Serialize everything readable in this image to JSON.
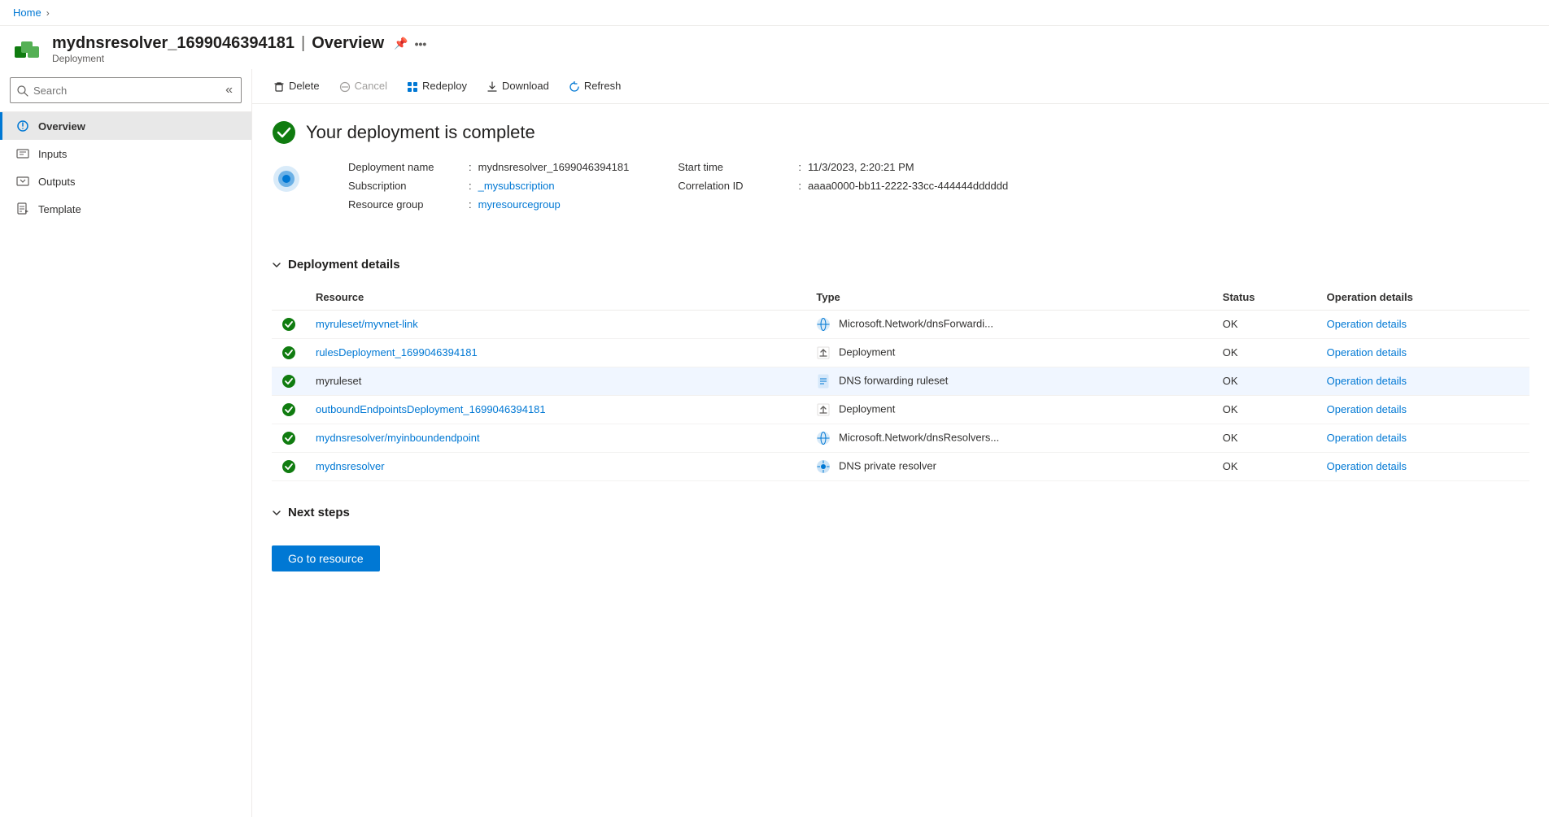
{
  "breadcrumb": {
    "home_label": "Home"
  },
  "header": {
    "title": "mydnsresolver_1699046394181",
    "separator": "|",
    "page": "Overview",
    "subtitle": "Deployment"
  },
  "sidebar": {
    "search_placeholder": "Search",
    "nav_items": [
      {
        "id": "overview",
        "label": "Overview",
        "active": true
      },
      {
        "id": "inputs",
        "label": "Inputs",
        "active": false
      },
      {
        "id": "outputs",
        "label": "Outputs",
        "active": false
      },
      {
        "id": "template",
        "label": "Template",
        "active": false
      }
    ]
  },
  "toolbar": {
    "delete_label": "Delete",
    "cancel_label": "Cancel",
    "redeploy_label": "Redeploy",
    "download_label": "Download",
    "refresh_label": "Refresh"
  },
  "overview": {
    "success_message": "Your deployment is complete",
    "deployment_info": {
      "deployment_name_label": "Deployment name",
      "deployment_name_value": "mydnsresolver_1699046394181",
      "subscription_label": "Subscription",
      "subscription_value": "_mysubscription",
      "resource_group_label": "Resource group",
      "resource_group_value": "myresourcegroup",
      "start_time_label": "Start time",
      "start_time_value": "11/3/2023, 2:20:21 PM",
      "correlation_id_label": "Correlation ID",
      "correlation_id_value": "aaaa0000-bb11-2222-33cc-444444dddddd"
    },
    "deployment_details_title": "Deployment details",
    "table_headers": {
      "resource": "Resource",
      "type": "Type",
      "status": "Status",
      "operation_details": "Operation details"
    },
    "table_rows": [
      {
        "id": 1,
        "resource": "myruleset/myvnet-link",
        "type": "Microsoft.Network/dnsForwardi...",
        "type_icon": "globe",
        "status": "OK",
        "operation_details": "Operation details",
        "highlighted": false
      },
      {
        "id": 2,
        "resource": "rulesDeployment_1699046394181",
        "type": "Deployment",
        "type_icon": "upload",
        "status": "OK",
        "operation_details": "Operation details",
        "highlighted": false
      },
      {
        "id": 3,
        "resource": "myruleset",
        "type": "DNS forwarding ruleset",
        "type_icon": "document",
        "status": "OK",
        "operation_details": "Operation details",
        "highlighted": true
      },
      {
        "id": 4,
        "resource": "outboundEndpointsDeployment_1699046394181",
        "type": "Deployment",
        "type_icon": "upload",
        "status": "OK",
        "operation_details": "Operation details",
        "highlighted": false
      },
      {
        "id": 5,
        "resource": "mydnsresolver/myinboundendpoint",
        "type": "Microsoft.Network/dnsResolvers...",
        "type_icon": "globe",
        "status": "OK",
        "operation_details": "Operation details",
        "highlighted": false
      },
      {
        "id": 6,
        "resource": "mydnsresolver",
        "type": "DNS private resolver",
        "type_icon": "dns-globe",
        "status": "OK",
        "operation_details": "Operation details",
        "highlighted": false
      }
    ],
    "next_steps_title": "Next steps",
    "go_to_resource_label": "Go to resource"
  }
}
